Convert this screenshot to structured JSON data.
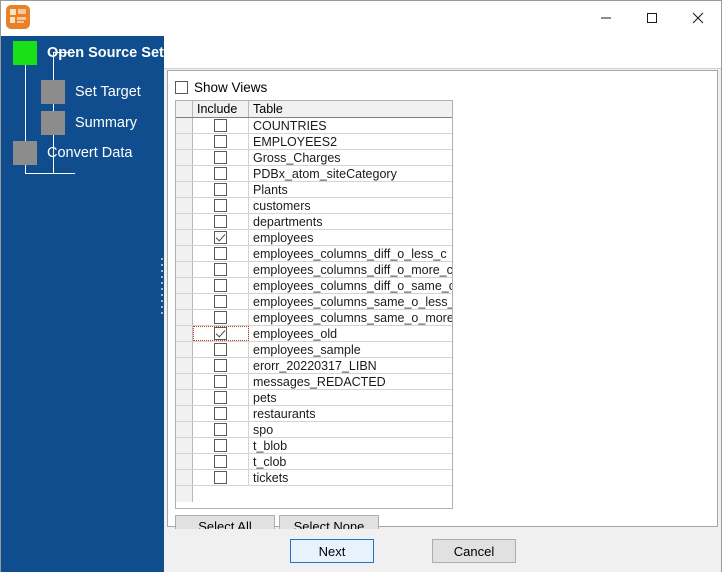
{
  "window": {
    "title": "",
    "icon": "app-icon",
    "controls": [
      {
        "name": "minimize",
        "glyph": "–"
      },
      {
        "name": "maximize",
        "glyph": "□"
      },
      {
        "name": "close",
        "glyph": "✕"
      }
    ]
  },
  "sidebar": {
    "background": "#104d8e",
    "active_color": "#19e019",
    "inactive_color": "#8c8c8c",
    "steps": [
      {
        "label": "Open Source Set",
        "active": true
      },
      {
        "label": "Set Target",
        "active": false
      },
      {
        "label": "Summary",
        "active": false
      },
      {
        "label": "Convert Data",
        "active": false
      }
    ]
  },
  "main": {
    "show_views": {
      "label": "Show Views",
      "checked": false
    },
    "grid": {
      "columns": [
        "",
        "Include",
        "Table"
      ],
      "rows": [
        {
          "include": false,
          "table": "COUNTRIES"
        },
        {
          "include": false,
          "table": "EMPLOYEES2"
        },
        {
          "include": false,
          "table": "Gross_Charges"
        },
        {
          "include": false,
          "table": "PDBx_atom_siteCategory"
        },
        {
          "include": false,
          "table": "Plants"
        },
        {
          "include": false,
          "table": "customers"
        },
        {
          "include": false,
          "table": "departments"
        },
        {
          "include": true,
          "table": "employees"
        },
        {
          "include": false,
          "table": "employees_columns_diff_o_less_c"
        },
        {
          "include": false,
          "table": "employees_columns_diff_o_more_c"
        },
        {
          "include": false,
          "table": "employees_columns_diff_o_same_c"
        },
        {
          "include": false,
          "table": "employees_columns_same_o_less_c"
        },
        {
          "include": false,
          "table": "employees_columns_same_o_more_c"
        },
        {
          "include": true,
          "table": "employees_old",
          "current": true
        },
        {
          "include": false,
          "table": "employees_sample"
        },
        {
          "include": false,
          "table": "erorr_20220317_LIBN"
        },
        {
          "include": false,
          "table": "messages_REDACTED"
        },
        {
          "include": false,
          "table": "pets"
        },
        {
          "include": false,
          "table": "restaurants"
        },
        {
          "include": false,
          "table": "spo"
        },
        {
          "include": false,
          "table": "t_blob"
        },
        {
          "include": false,
          "table": "t_clob"
        },
        {
          "include": false,
          "table": "tickets"
        }
      ]
    },
    "select_all_label": "Select All",
    "select_none_label": "Select None"
  },
  "footer": {
    "next_label": "Next",
    "cancel_label": "Cancel",
    "accent_color": "#1d74c8"
  }
}
